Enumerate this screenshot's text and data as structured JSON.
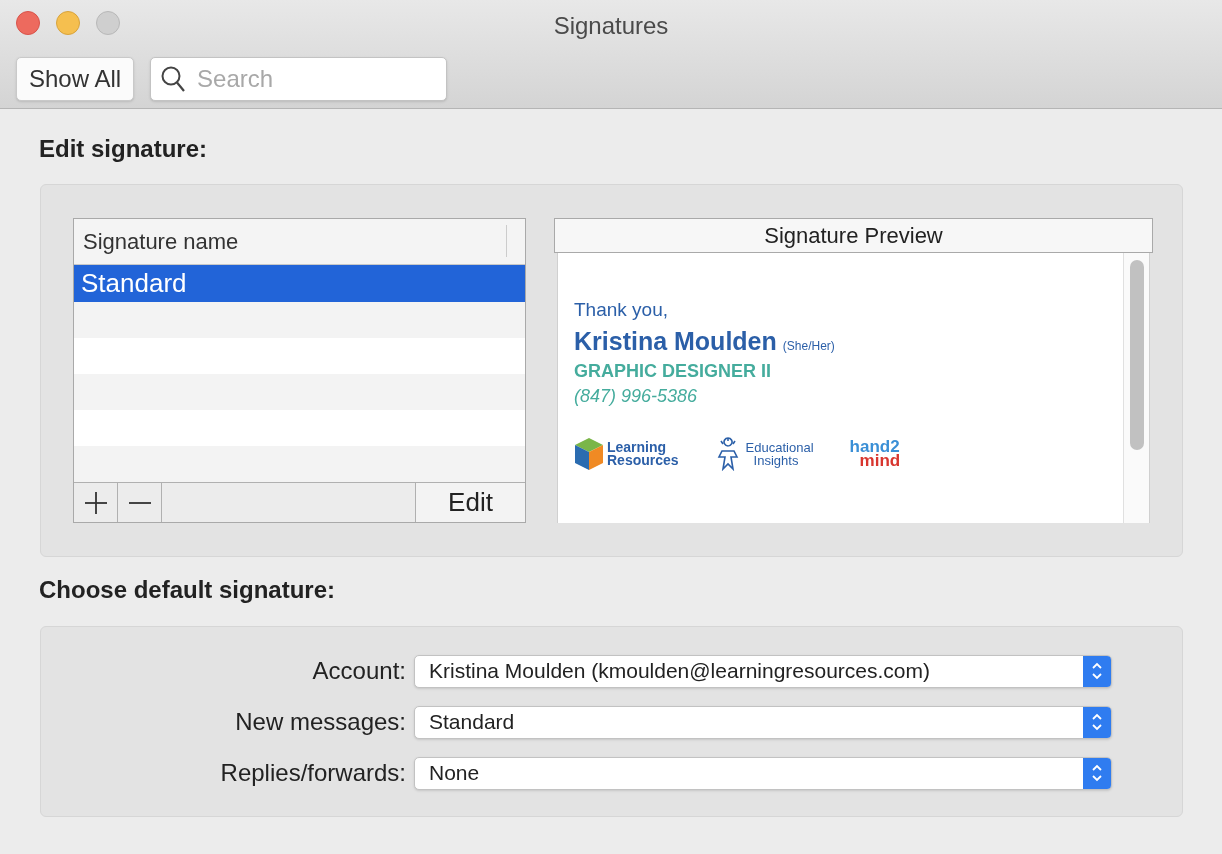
{
  "window": {
    "title": "Signatures"
  },
  "toolbar": {
    "show_all": "Show All",
    "search": {
      "placeholder": "Search"
    }
  },
  "edit_signature": {
    "heading": "Edit signature:",
    "list": {
      "column": "Signature name",
      "items": [
        {
          "name": "Standard",
          "selected": true
        }
      ]
    },
    "edit_button": "Edit",
    "preview": {
      "header": "Signature Preview",
      "greeting": "Thank you,",
      "name": "Kristina Moulden",
      "pronouns": "(She/Her)",
      "job_title": "GRAPHIC DESIGNER II",
      "phone": "(847) 996-5386",
      "logos": [
        {
          "kind": "cube",
          "lines": [
            "Learning",
            "Resources"
          ]
        },
        {
          "kind": "figure",
          "lines": [
            "Educational",
            "Insights"
          ]
        },
        {
          "kind": "twotone",
          "lines": [
            "hand2",
            "mind"
          ]
        }
      ]
    }
  },
  "default_signature": {
    "heading": "Choose default signature:",
    "fields": [
      {
        "label": "Account:",
        "value": "Kristina Moulden (kmoulden@learningresources.com)"
      },
      {
        "label": "New messages:",
        "value": "Standard"
      },
      {
        "label": "Replies/forwards:",
        "value": "None"
      }
    ]
  }
}
